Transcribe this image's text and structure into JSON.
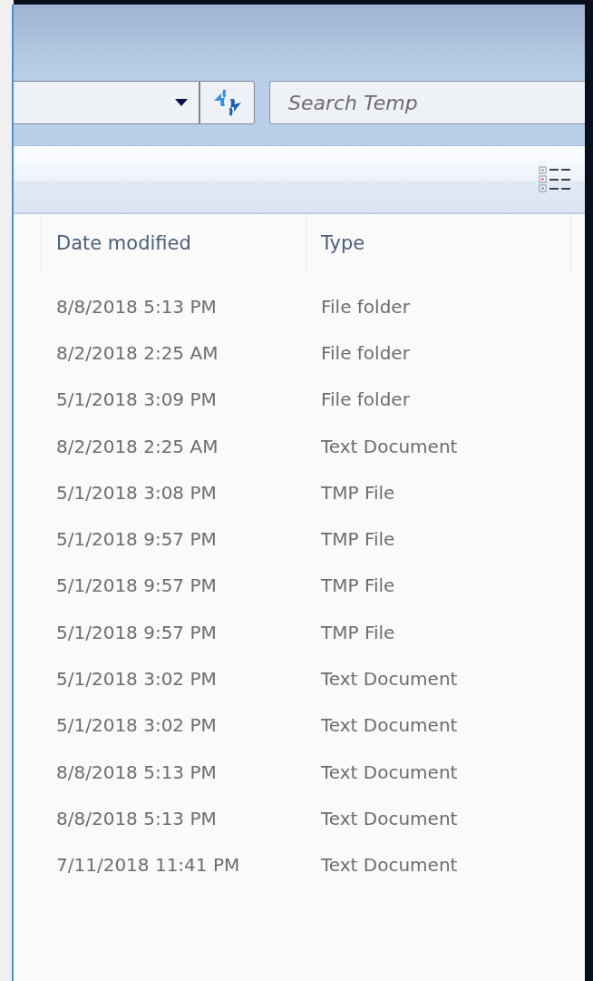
{
  "search": {
    "placeholder": "Search Temp"
  },
  "table": {
    "columns": [
      "Date modified",
      "Type"
    ],
    "rows": [
      {
        "date_modified": "8/8/2018 5:13 PM",
        "type": "File folder"
      },
      {
        "date_modified": "8/2/2018 2:25 AM",
        "type": "File folder"
      },
      {
        "date_modified": "5/1/2018 3:09 PM",
        "type": "File folder"
      },
      {
        "date_modified": "8/2/2018 2:25 AM",
        "type": "Text Document"
      },
      {
        "date_modified": "5/1/2018 3:08 PM",
        "type": "TMP File"
      },
      {
        "date_modified": "5/1/2018 9:57 PM",
        "type": "TMP File"
      },
      {
        "date_modified": "5/1/2018 9:57 PM",
        "type": "TMP File"
      },
      {
        "date_modified": "5/1/2018 9:57 PM",
        "type": "TMP File"
      },
      {
        "date_modified": "5/1/2018 3:02 PM",
        "type": "Text Document"
      },
      {
        "date_modified": "5/1/2018 3:02 PM",
        "type": "Text Document"
      },
      {
        "date_modified": "8/8/2018 5:13 PM",
        "type": "Text Document"
      },
      {
        "date_modified": "8/8/2018 5:13 PM",
        "type": "Text Document"
      },
      {
        "date_modified": "7/11/2018 11:41 PM",
        "type": "Text Document"
      }
    ]
  }
}
